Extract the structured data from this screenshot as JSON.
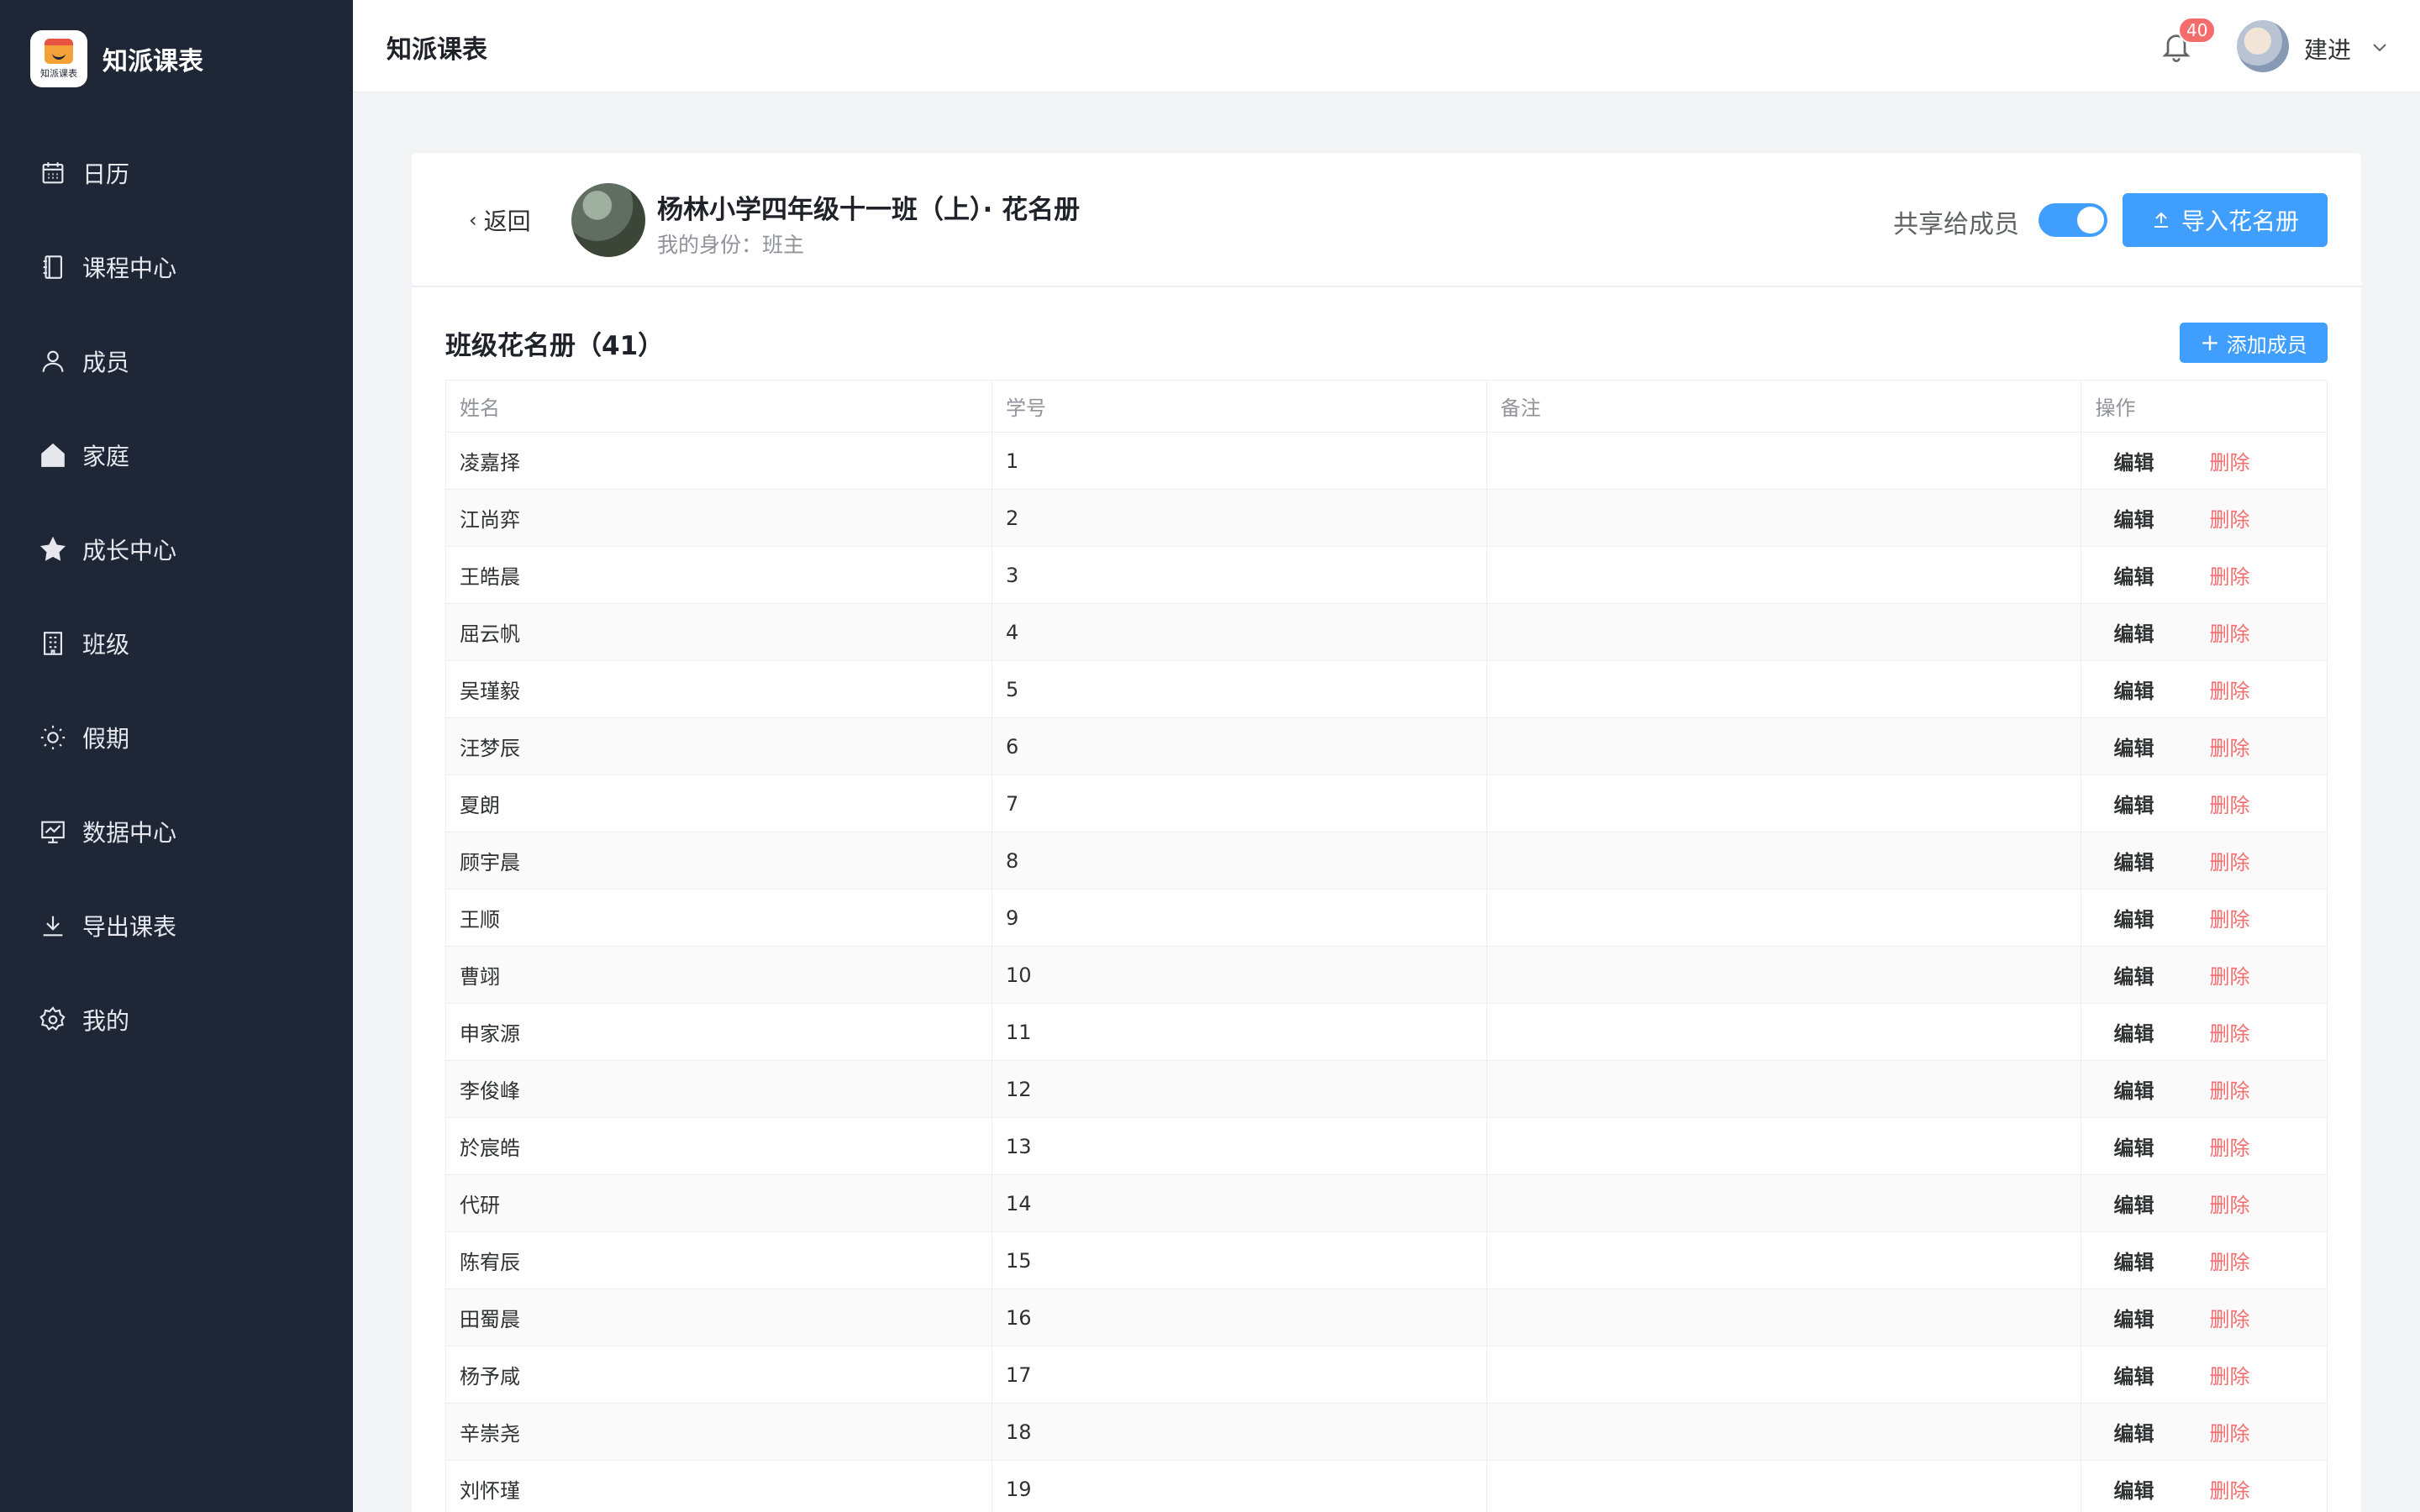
{
  "app": {
    "brand_name": "知派课表",
    "logo_text": "知派课表"
  },
  "sidebar": {
    "items": [
      {
        "label": "日历",
        "icon": "calendar-icon"
      },
      {
        "label": "课程中心",
        "icon": "notebook-icon"
      },
      {
        "label": "成员",
        "icon": "user-icon"
      },
      {
        "label": "家庭",
        "icon": "home-icon"
      },
      {
        "label": "成长中心",
        "icon": "star-icon"
      },
      {
        "label": "班级",
        "icon": "building-icon"
      },
      {
        "label": "假期",
        "icon": "sun-icon"
      },
      {
        "label": "数据中心",
        "icon": "chart-icon"
      },
      {
        "label": "导出课表",
        "icon": "download-icon"
      },
      {
        "label": "我的",
        "icon": "gear-icon"
      }
    ]
  },
  "header": {
    "title": "知派课表",
    "notification_count": "40",
    "user_name": "建进"
  },
  "roster": {
    "back_label": "返回",
    "group_title": "杨林小学四年级十一班（上）· 花名册",
    "my_role": "我的身份：班主",
    "share_label": "共享给成员",
    "share_enabled": true,
    "import_button": "导入花名册",
    "list_title": "班级花名册（41）",
    "add_button": "添加成员",
    "columns": [
      "姓名",
      "学号",
      "备注",
      "操作"
    ],
    "edit_label": "编辑",
    "delete_label": "删除",
    "rows": [
      {
        "name": "凌嘉择",
        "id": "1",
        "note": ""
      },
      {
        "name": "江尚弈",
        "id": "2",
        "note": ""
      },
      {
        "name": "王皓晨",
        "id": "3",
        "note": ""
      },
      {
        "name": "屈云帆",
        "id": "4",
        "note": ""
      },
      {
        "name": "吴瑾毅",
        "id": "5",
        "note": ""
      },
      {
        "name": "汪梦辰",
        "id": "6",
        "note": ""
      },
      {
        "name": "夏朗",
        "id": "7",
        "note": ""
      },
      {
        "name": "顾宇晨",
        "id": "8",
        "note": ""
      },
      {
        "name": "王顺",
        "id": "9",
        "note": ""
      },
      {
        "name": "曹翊",
        "id": "10",
        "note": ""
      },
      {
        "name": "申家源",
        "id": "11",
        "note": ""
      },
      {
        "name": "李俊峰",
        "id": "12",
        "note": ""
      },
      {
        "name": "於宸皓",
        "id": "13",
        "note": ""
      },
      {
        "name": "代研",
        "id": "14",
        "note": ""
      },
      {
        "name": "陈宥辰",
        "id": "15",
        "note": ""
      },
      {
        "name": "田蜀晨",
        "id": "16",
        "note": ""
      },
      {
        "name": "杨予咸",
        "id": "17",
        "note": ""
      },
      {
        "name": "辛崇尧",
        "id": "18",
        "note": ""
      },
      {
        "name": "刘怀瑾",
        "id": "19",
        "note": ""
      }
    ]
  },
  "colors": {
    "sidebar_bg": "#1f2737",
    "accent": "#409eff",
    "danger": "#f56c6c",
    "page_bg": "#f3f4f6"
  }
}
